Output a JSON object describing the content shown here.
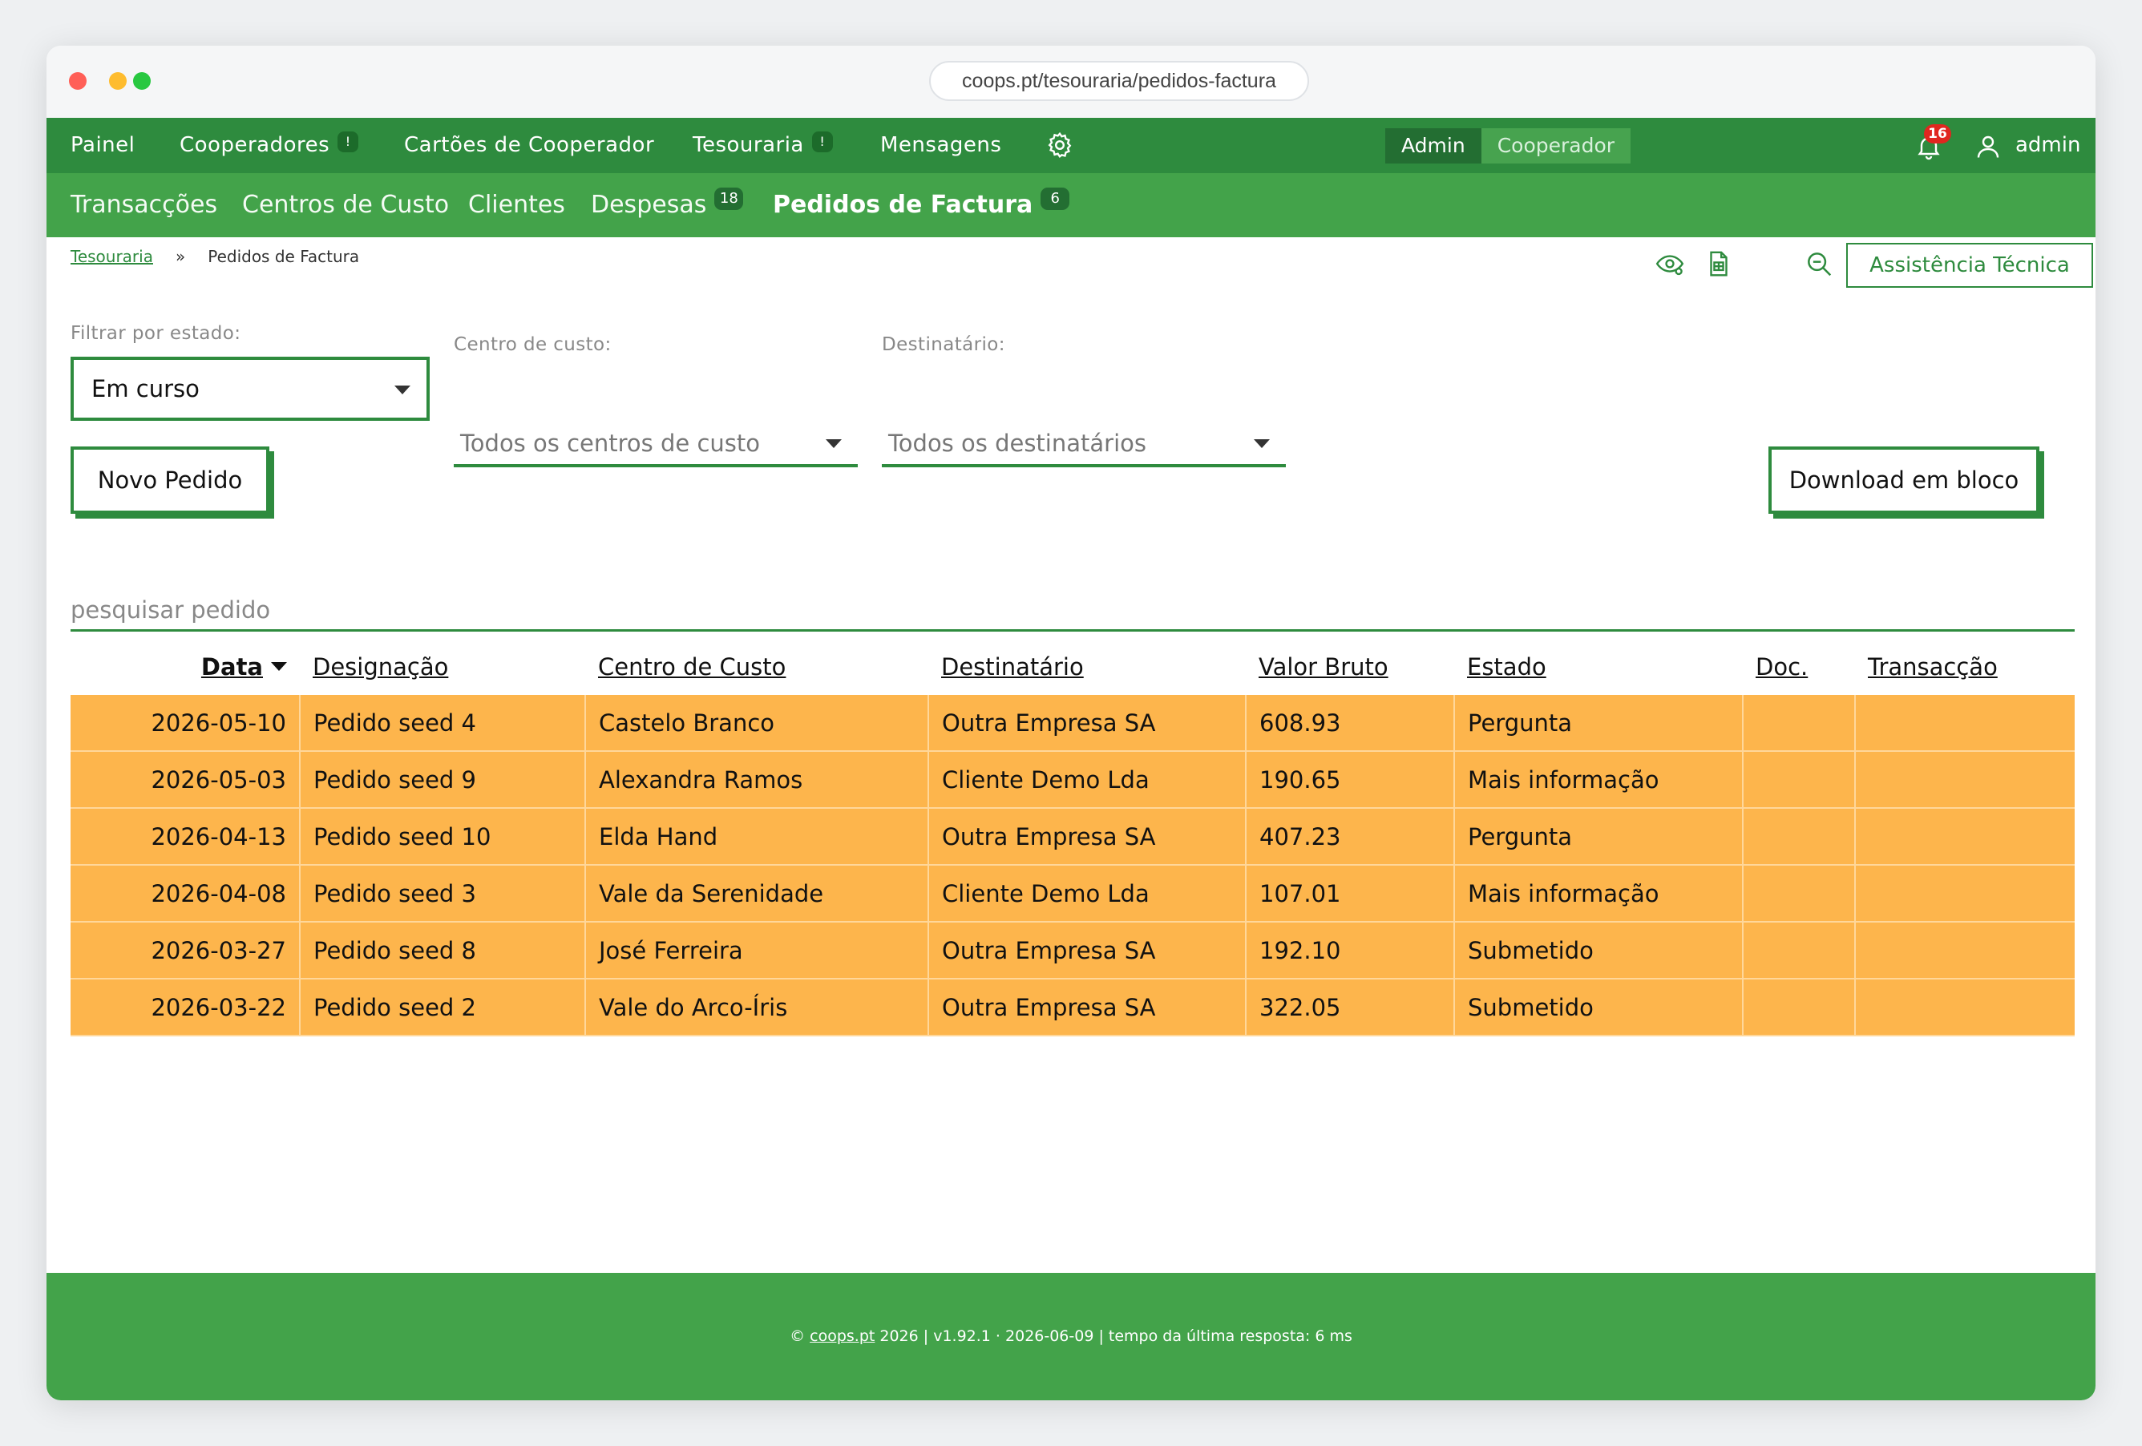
{
  "browser": {
    "url": "coops.pt/tesouraria/pedidos-factura"
  },
  "topnav": {
    "items": [
      {
        "label": "Painel",
        "badge": ""
      },
      {
        "label": "Cooperadores",
        "badge": "!"
      },
      {
        "label": "Cartões de Cooperador",
        "badge": ""
      },
      {
        "label": "Tesouraria",
        "badge": "!"
      },
      {
        "label": "Mensagens",
        "badge": ""
      }
    ],
    "roles": {
      "admin": "Admin",
      "cooperador": "Cooperador"
    },
    "notifications_count": "16",
    "username": "admin"
  },
  "subnav": {
    "items": [
      {
        "label": "Transacções"
      },
      {
        "label": "Centros de Custo"
      },
      {
        "label": "Clientes"
      },
      {
        "label": "Despesas",
        "badge": "18"
      },
      {
        "label": "Pedidos de Factura",
        "badge": "6"
      }
    ]
  },
  "breadcrumb": {
    "parent": "Tesouraria",
    "separator": "»",
    "current": "Pedidos de Factura"
  },
  "toolbar": {
    "support_label": "Assistência Técnica"
  },
  "filters": {
    "estado": {
      "label": "Filtrar por estado:",
      "value": "Em curso"
    },
    "centro": {
      "label": "Centro de custo:",
      "value": "Todos os centros de custo"
    },
    "destinatario": {
      "label": "Destinatário:",
      "value": "Todos os destinatários"
    }
  },
  "actions": {
    "new_label": "Novo Pedido",
    "download_label": "Download em bloco"
  },
  "search": {
    "placeholder": "pesquisar pedido"
  },
  "table": {
    "headers": [
      "Data",
      "Designação",
      "Centro de Custo",
      "Destinatário",
      "Valor Bruto",
      "Estado",
      "Doc.",
      "Transacção"
    ],
    "rows": [
      [
        "2026-05-10",
        "Pedido seed 4",
        "Castelo Branco",
        "Outra Empresa SA",
        "608.93",
        "Pergunta",
        "",
        ""
      ],
      [
        "2026-05-03",
        "Pedido seed 9",
        "Alexandra Ramos",
        "Cliente Demo Lda",
        "190.65",
        "Mais informação",
        "",
        ""
      ],
      [
        "2026-04-13",
        "Pedido seed 10",
        "Elda Hand",
        "Outra Empresa SA",
        "407.23",
        "Pergunta",
        "",
        ""
      ],
      [
        "2026-04-08",
        "Pedido seed 3",
        "Vale da Serenidade",
        "Cliente Demo Lda",
        "107.01",
        "Mais informação",
        "",
        ""
      ],
      [
        "2026-03-27",
        "Pedido seed 8",
        "José Ferreira",
        "Outra Empresa SA",
        "192.10",
        "Submetido",
        "",
        ""
      ],
      [
        "2026-03-22",
        "Pedido seed 2",
        "Vale do Arco-Íris",
        "Outra Empresa SA",
        "322.05",
        "Submetido",
        "",
        ""
      ]
    ]
  },
  "footer": {
    "copyright": "©",
    "site": "coops.pt",
    "rest": " 2026 | v1.92.1 · 2026-06-09 | tempo da última resposta: 6 ms"
  },
  "colors": {
    "primary": "#2e8b3e",
    "secondary": "#43a34a",
    "row_highlight": "#fdb54c",
    "badge_red": "#e0261f"
  }
}
